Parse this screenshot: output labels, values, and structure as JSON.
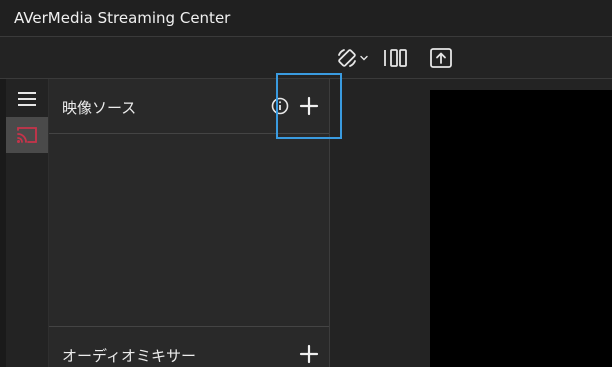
{
  "window": {
    "title": "AVerMedia Streaming Center"
  },
  "toolbar": {
    "buttons": [
      {
        "name": "rotate-orientation",
        "icon": "rotate-device-icon",
        "has_dropdown": true
      },
      {
        "name": "layout-split",
        "icon": "split-layout-icon"
      },
      {
        "name": "upload",
        "icon": "upload-icon"
      }
    ]
  },
  "sidebar": {
    "items": [
      {
        "name": "menu",
        "icon": "hamburger-icon"
      },
      {
        "name": "cast",
        "icon": "cast-icon",
        "active": true
      }
    ]
  },
  "video_sources": {
    "title": "映像ソース",
    "info_icon": "info-icon",
    "add_icon": "plus-icon"
  },
  "audio_mixer": {
    "title": "オーディオミキサー",
    "add_icon": "plus-icon"
  },
  "colors": {
    "background": "#1b1b1b",
    "panel": "#292929",
    "highlight": "#3a9be0",
    "cast_icon": "#c8334a",
    "preview": "#000000"
  }
}
